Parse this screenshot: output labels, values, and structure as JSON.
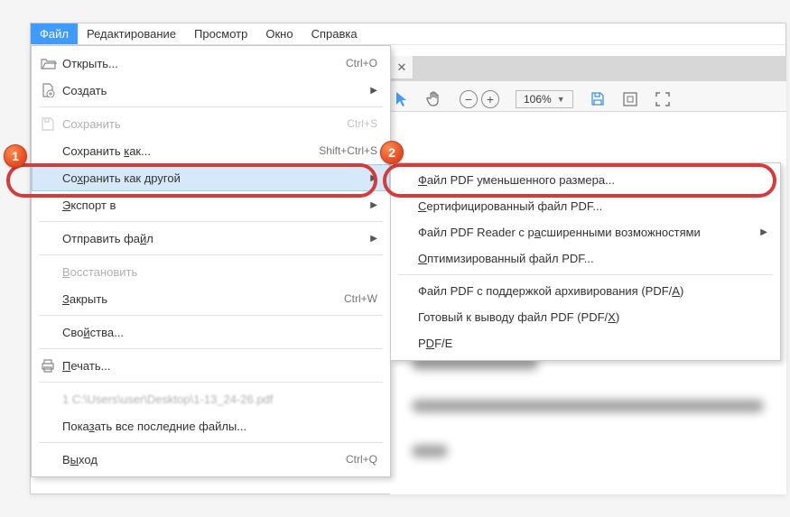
{
  "menubar": {
    "items": [
      "Файл",
      "Редактирование",
      "Просмотр",
      "Окно",
      "Справка"
    ],
    "active_index": 0
  },
  "toolbar": {
    "zoom_value": "106%"
  },
  "file_menu": {
    "open": {
      "label": "Открыть...",
      "shortcut": "Ctrl+O"
    },
    "create": {
      "label": "Создать"
    },
    "save": {
      "label": "Сохранить",
      "shortcut": "Ctrl+S"
    },
    "save_as": {
      "label": "Сохранить как...",
      "shortcut": "Shift+Ctrl+S"
    },
    "save_as_other": {
      "label": "Сохранить как другой"
    },
    "export": {
      "label": "Экспорт в"
    },
    "send": {
      "label": "Отправить файл"
    },
    "restore": {
      "label": "Восстановить"
    },
    "close": {
      "label": "Закрыть",
      "shortcut": "Ctrl+W"
    },
    "properties": {
      "label": "Свойства..."
    },
    "print": {
      "label": "Печать..."
    },
    "recent_file": {
      "label": "1 C:\\Users\\user\\Desktop\\1-13_24-26.pdf"
    },
    "show_recent": {
      "label": "Показать все последние файлы..."
    },
    "exit": {
      "label": "Выход",
      "shortcut": "Ctrl+Q"
    }
  },
  "save_as_other_submenu": {
    "reduced": {
      "label": "Файл PDF уменьшенного размера..."
    },
    "certified": {
      "label": "Сертифицированный файл PDF..."
    },
    "reader": {
      "label": "Файл PDF Reader с расширенными возможностями"
    },
    "optimized": {
      "label": "Оптимизированный файл PDF..."
    },
    "archive": {
      "label": "Файл PDF с поддержкой архивирования (PDF/A)"
    },
    "press": {
      "label": "Готовый к выводу файл PDF (PDF/X)"
    },
    "pdfe": {
      "label": "PDF/E"
    }
  },
  "annotations": {
    "badge1": "1",
    "badge2": "2"
  }
}
